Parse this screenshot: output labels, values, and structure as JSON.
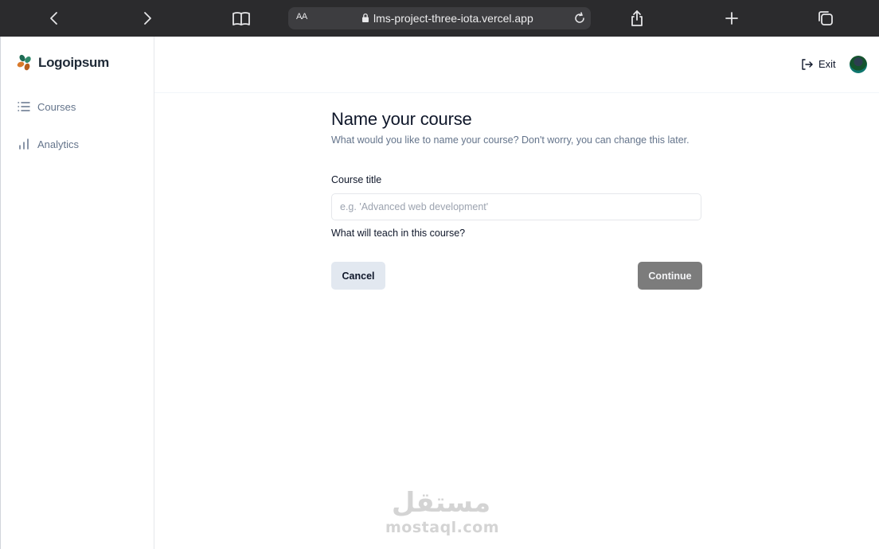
{
  "browser": {
    "address_aa": "AA",
    "url": "lms-project-three-iota.vercel.app"
  },
  "sidebar": {
    "logo_text": "Logoipsum",
    "items": [
      {
        "label": "Courses",
        "icon": "list-icon"
      },
      {
        "label": "Analytics",
        "icon": "bar-chart-icon"
      }
    ]
  },
  "header": {
    "exit_label": "Exit"
  },
  "main": {
    "title": "Name your course",
    "subtitle": "What would you like to name your course? Don't worry, you can change this later.",
    "field_label": "Course title",
    "input_placeholder": "e.g. 'Advanced web development'",
    "input_value": "",
    "helper_text": "What will teach in this course?",
    "cancel_label": "Cancel",
    "continue_label": "Continue"
  },
  "watermark": {
    "arabic": "مستقل",
    "latin": "mostaql.com"
  },
  "colors": {
    "browser_bar": "#2b2b2d",
    "continue_button": "#7c7c7c",
    "cancel_button": "#e2e8f0",
    "logo_green": "#1f6b54",
    "logo_orange": "#d97a2b"
  }
}
